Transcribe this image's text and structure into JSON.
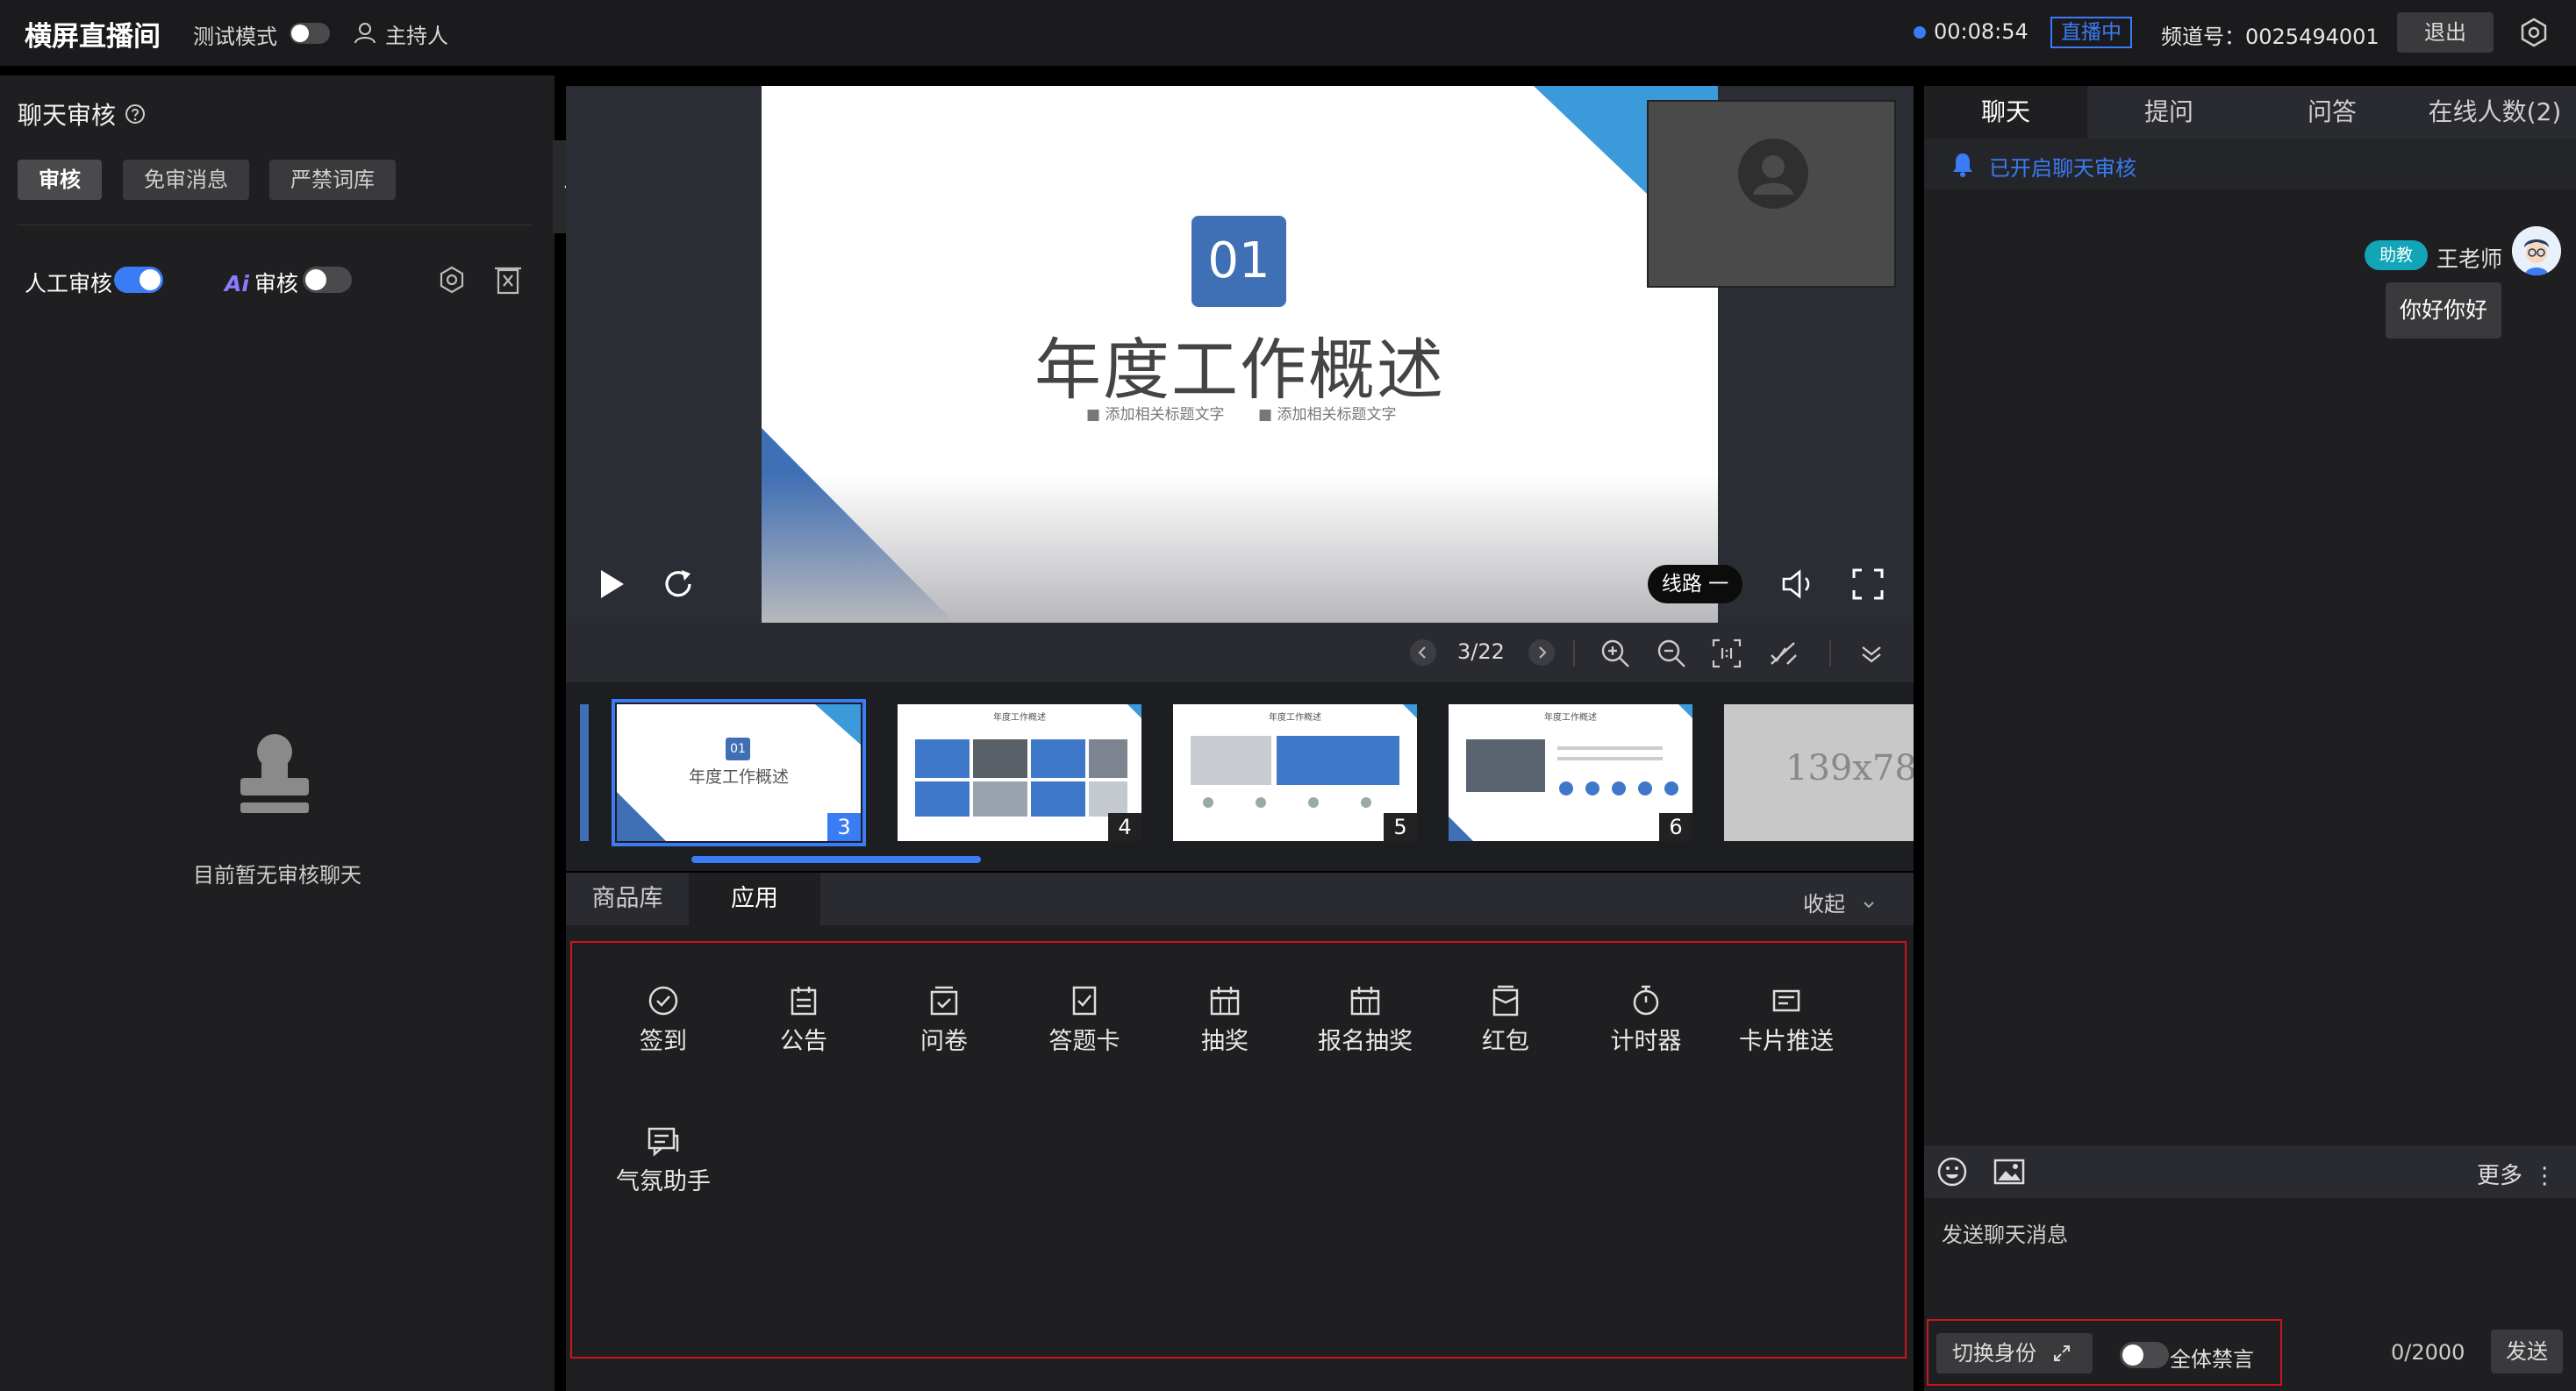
{
  "topbar": {
    "title": "横屏直播间",
    "test_mode_label": "测试模式",
    "test_mode_on": false,
    "role_label": "主持人",
    "live_duration": "00:08:54",
    "live_status": "直播中",
    "channel_label": "频道号：0025494001",
    "exit_label": "退出"
  },
  "left_panel": {
    "title": "聊天审核",
    "tabs": [
      {
        "label": "审核",
        "active": true
      },
      {
        "label": "免审消息",
        "active": false
      },
      {
        "label": "严禁词库",
        "active": false
      }
    ],
    "manual_review_label": "人工审核",
    "manual_review_on": true,
    "ai_prefix": "Ai",
    "ai_review_label": "审核",
    "ai_review_on": false,
    "empty_text": "目前暂无审核聊天"
  },
  "player": {
    "slide_number": "01",
    "slide_title": "年度工作概述",
    "slide_subtitles": [
      "■ 添加相关标题文字",
      "■ 添加相关标题文字"
    ],
    "line_label": "线路 一",
    "page_indicator": "3/22"
  },
  "thumbnails": [
    {
      "num": "3",
      "active": true,
      "title": "年度工作概述",
      "badge": "01"
    },
    {
      "num": "4",
      "active": false,
      "title": "年度工作概述"
    },
    {
      "num": "5",
      "active": false,
      "title": "年度工作概述"
    },
    {
      "num": "6",
      "active": false,
      "title": "年度工作概述"
    },
    {
      "num": "",
      "active": false,
      "placeholder": "139x78"
    }
  ],
  "apps_panel": {
    "tabs": [
      {
        "label": "商品库",
        "active": false
      },
      {
        "label": "应用",
        "active": true
      }
    ],
    "collapse_label": "收起",
    "apps": [
      {
        "label": "签到",
        "icon": "check-circle-icon"
      },
      {
        "label": "公告",
        "icon": "announcement-icon"
      },
      {
        "label": "问卷",
        "icon": "questionnaire-icon"
      },
      {
        "label": "答题卡",
        "icon": "answer-card-icon"
      },
      {
        "label": "抽奖",
        "icon": "lottery-icon"
      },
      {
        "label": "报名抽奖",
        "icon": "signup-lottery-icon"
      },
      {
        "label": "红包",
        "icon": "red-packet-icon"
      },
      {
        "label": "计时器",
        "icon": "timer-icon"
      },
      {
        "label": "卡片推送",
        "icon": "card-push-icon"
      },
      {
        "label": "气氛助手",
        "icon": "atmosphere-icon"
      }
    ]
  },
  "right_panel": {
    "tabs": [
      {
        "label": "聊天",
        "active": true
      },
      {
        "label": "提问",
        "active": false
      },
      {
        "label": "问答",
        "active": false
      },
      {
        "label": "在线人数(2)",
        "active": false
      }
    ],
    "notice": "已开启聊天审核",
    "message": {
      "badge": "助教",
      "name": "王老师",
      "text": "你好你好"
    },
    "more_label": "更多",
    "input_placeholder": "发送聊天消息",
    "switch_identity_label": "切换身份",
    "mute_all_label": "全体禁言",
    "mute_all_on": false,
    "char_counter": "0/2000",
    "send_label": "发送"
  },
  "colors": {
    "accent": "#3a7cf5",
    "panel_bg": "#1f1f21",
    "highlight_border": "#c8161d",
    "slide_blue": "#3f6fb5",
    "badge_teal": "#12a5b8"
  }
}
